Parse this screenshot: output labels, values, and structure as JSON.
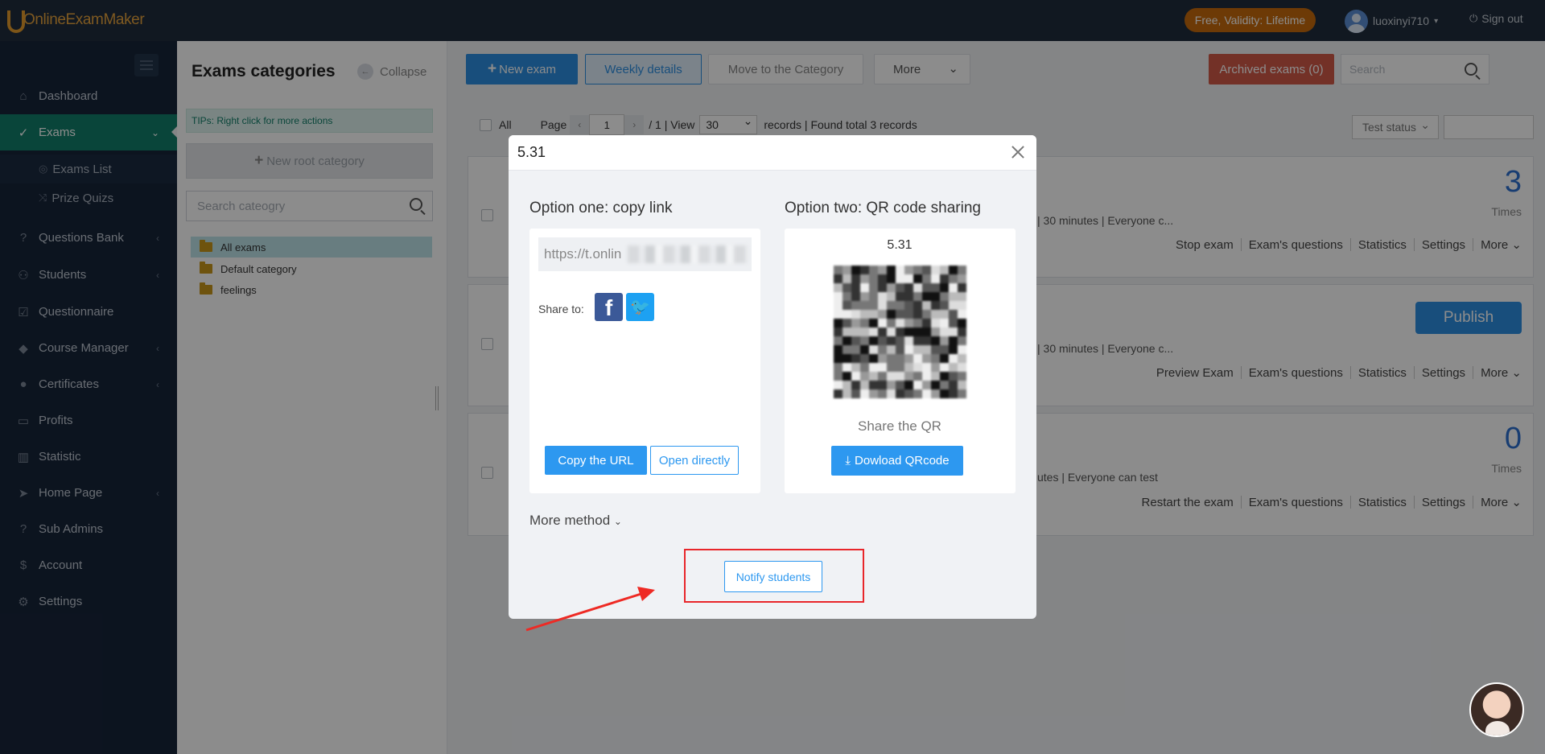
{
  "app": {
    "logo_text": "OnlineExamMaker",
    "plan_badge": "Free, Validity: Lifetime",
    "username": "luoxinyi710",
    "signout": "Sign out"
  },
  "sidebar": {
    "items": [
      {
        "label": "Dashboard",
        "icon": "home-icon"
      },
      {
        "label": "Exams",
        "icon": "check-circle-icon"
      },
      {
        "label": "Questions Bank",
        "icon": "question-icon"
      },
      {
        "label": "Students",
        "icon": "users-icon"
      },
      {
        "label": "Questionnaire",
        "icon": "checkbox-icon"
      },
      {
        "label": "Course Manager",
        "icon": "graduation-icon"
      },
      {
        "label": "Certificates",
        "icon": "certificate-icon"
      },
      {
        "label": "Profits",
        "icon": "card-icon"
      },
      {
        "label": "Statistic",
        "icon": "bar-chart-icon"
      },
      {
        "label": "Home Page",
        "icon": "paper-plane-icon"
      },
      {
        "label": "Sub Admins",
        "icon": "question-icon"
      },
      {
        "label": "Account",
        "icon": "dollar-icon"
      },
      {
        "label": "Settings",
        "icon": "gear-icon"
      }
    ],
    "sub_items": [
      {
        "label": "Exams List"
      },
      {
        "label": "Prize Quizs"
      }
    ]
  },
  "categories": {
    "title": "Exams categories",
    "collapse": "Collapse",
    "tips": "TIPs:  Right click for more actions",
    "new_root": "New root category",
    "search_placeholder": "Search cateogry",
    "tree": [
      "All exams",
      "Default category",
      "feelings"
    ]
  },
  "toolbar": {
    "new_exam": "New exam",
    "weekly": "Weekly details",
    "move": "Move to the Category",
    "more": "More",
    "archived": "Archived exams (0)",
    "search_placeholder": "Search"
  },
  "pager": {
    "all": "All",
    "page": "Page",
    "page_value": "1",
    "of": "/ 1 | View",
    "per_page": "30",
    "records": "records | Found total 3 records",
    "status": "Test status"
  },
  "exams": [
    {
      "meta": "| 30 minutes | Everyone c...",
      "count": "3",
      "times": "Times",
      "actions": [
        "Stop exam",
        "Exam's questions",
        "Statistics",
        "Settings",
        "More"
      ]
    },
    {
      "meta": "| 30 minutes | Everyone c...",
      "publish": "Publish",
      "actions": [
        "Preview Exam",
        "Exam's questions",
        "Statistics",
        "Settings",
        "More"
      ]
    },
    {
      "meta": "utes | Everyone can test",
      "count": "0",
      "times": "Times",
      "actions": [
        "Restart the exam",
        "Exam's questions",
        "Statistics",
        "Settings",
        "More"
      ]
    }
  ],
  "modal": {
    "title": "5.31",
    "option_one": "Option one: copy link",
    "option_two": "Option two: QR code sharing",
    "url": "https://t.onlin",
    "share_to": "Share to:",
    "copy_url": "Copy the URL",
    "open_directly": "Open directly",
    "qr_name": "5.31",
    "share_qr": "Share the QR",
    "download_qr": "Dowload QRcode",
    "more_method": "More method",
    "notify": "Notify students"
  },
  "colors": {
    "topbar": "#1f2d3d",
    "sidebar": "#17253a",
    "active": "#127f6a",
    "primary": "#2d8fe2",
    "highlight": "#e8262a"
  }
}
